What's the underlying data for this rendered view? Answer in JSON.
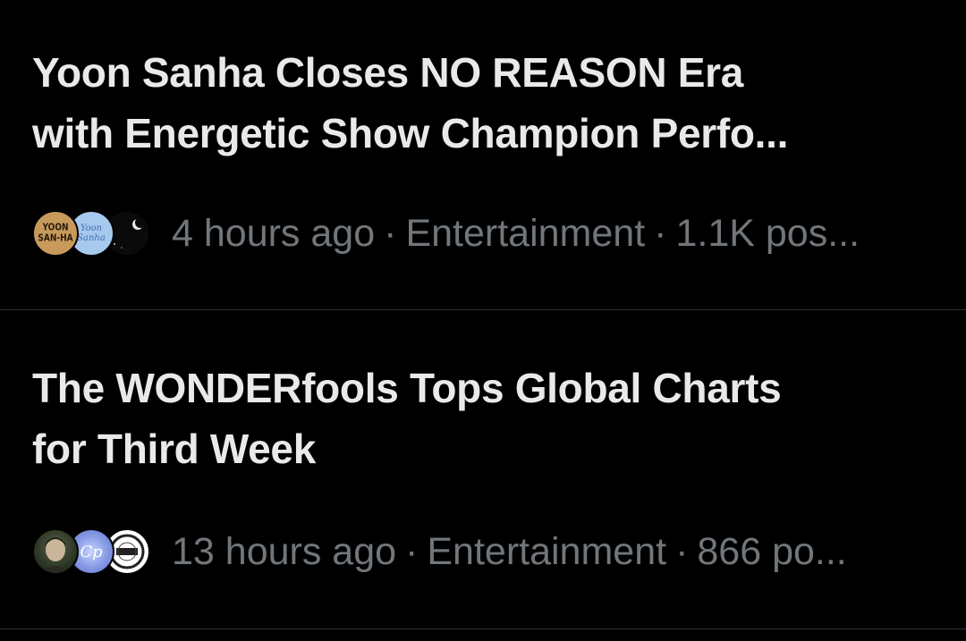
{
  "trends": [
    {
      "headline_line1": "Yoon Sanha Closes NO REASON Era",
      "headline_line2": "with Energetic Show Champion Perfo...",
      "time": "4 hours ago",
      "category": "Entertainment",
      "posts": "1.1K pos...",
      "separator": "·",
      "avatars": [
        {
          "icon": "yoon-sanha-logo-avatar",
          "text": "YOON SAN-HA"
        },
        {
          "icon": "sanha-script-avatar",
          "text": "Yoon Sanha"
        },
        {
          "icon": "crescent-moon-avatar",
          "text": ""
        }
      ]
    },
    {
      "headline_line1": "The WONDERfools Tops Global Charts",
      "headline_line2": "for Third Week",
      "time": "13 hours ago",
      "category": "Entertainment",
      "posts": "866 po...",
      "separator": "·",
      "avatars": [
        {
          "icon": "portrait-avatar",
          "text": ""
        },
        {
          "icon": "cp-logo-avatar",
          "text": "Cp"
        },
        {
          "icon": "emblem-badge-avatar",
          "text": ""
        }
      ]
    }
  ],
  "colors": {
    "background": "#000000",
    "headline": "#e7e9ea",
    "meta": "#71767b",
    "divider": "#2f3336"
  }
}
